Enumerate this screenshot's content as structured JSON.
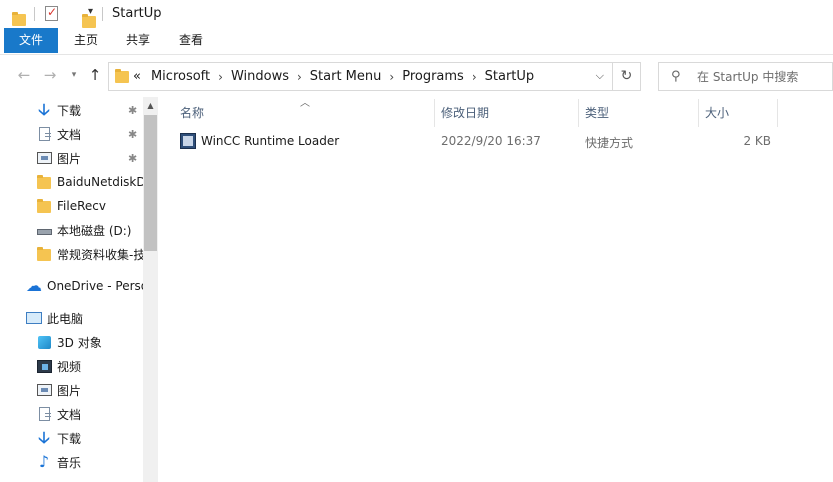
{
  "window": {
    "title": "StartUp"
  },
  "ribbon": {
    "tabs": [
      {
        "label": "文件"
      },
      {
        "label": "主页"
      },
      {
        "label": "共享"
      },
      {
        "label": "查看"
      }
    ]
  },
  "address": {
    "prefix": "«",
    "crumbs": [
      "Microsoft",
      "Windows",
      "Start Menu",
      "Programs",
      "StartUp"
    ],
    "separator": "›"
  },
  "search": {
    "placeholder": "在 StartUp 中搜索"
  },
  "nav": {
    "quick_access": [
      {
        "label": "下载",
        "icon": "download-icon",
        "pinned": true
      },
      {
        "label": "文档",
        "icon": "document-icon",
        "pinned": true
      },
      {
        "label": "图片",
        "icon": "picture-icon",
        "pinned": true
      },
      {
        "label": "BaiduNetdiskD",
        "icon": "folder-icon",
        "pinned": false
      },
      {
        "label": "FileRecv",
        "icon": "folder-icon",
        "pinned": false
      },
      {
        "label": "本地磁盘 (D:)",
        "icon": "drive-icon",
        "pinned": false
      },
      {
        "label": "常规资料收集-技",
        "icon": "folder-icon",
        "pinned": false
      }
    ],
    "onedrive": {
      "label": "OneDrive - Perso",
      "icon": "cloud-icon"
    },
    "this_pc": {
      "label": "此电脑",
      "icon": "computer-icon"
    },
    "this_pc_items": [
      {
        "label": "3D 对象",
        "icon": "3d-objects-icon"
      },
      {
        "label": "视频",
        "icon": "video-icon"
      },
      {
        "label": "图片",
        "icon": "picture-icon"
      },
      {
        "label": "文档",
        "icon": "document-icon"
      },
      {
        "label": "下载",
        "icon": "download-icon"
      },
      {
        "label": "音乐",
        "icon": "music-icon"
      }
    ]
  },
  "file_list": {
    "columns": [
      "名称",
      "修改日期",
      "类型",
      "大小"
    ],
    "rows": [
      {
        "name": "WinCC Runtime Loader",
        "modified": "2022/9/20 16:37",
        "type": "快捷方式",
        "size": "2 KB",
        "icon": "wincc-shortcut-icon"
      }
    ]
  },
  "colors": {
    "accent": "#1979ca",
    "header_text": "#4c607a"
  }
}
